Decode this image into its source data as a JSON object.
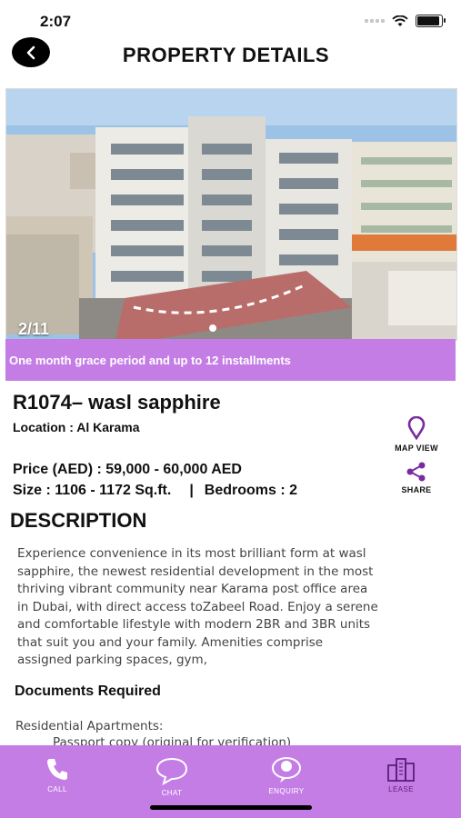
{
  "status": {
    "time": "2:07"
  },
  "header": {
    "title": "PROPERTY DETAILS"
  },
  "gallery": {
    "counter": "2/11"
  },
  "promo": "One month grace period and up to 12 installments",
  "property": {
    "name": "R1074– wasl sapphire",
    "location": "Location :  Al Karama",
    "price": "Price (AED) :   59,000 - 60,000 AED",
    "size": "Size : 1106 - 1172  Sq.ft.",
    "separator": "|",
    "bedrooms": "Bedrooms : 2"
  },
  "actions": {
    "map_view": "MAP VIEW",
    "share": "SHARE"
  },
  "description": {
    "heading": "DESCRIPTION",
    "text": "Experience convenience in its most brilliant form at wasl sapphire, the newest residential development in the most thriving vibrant community near Karama post office area in Dubai, with direct access toZabeel Road. Enjoy a serene and comfortable lifestyle with modern 2BR and 3BR units that suit you and your family. Amenities comprise assigned parking spaces, gym,"
  },
  "documents": {
    "heading": "Documents Required",
    "subheading": "Residential Apartments:",
    "first_item": "Passport copy (original for verification)"
  },
  "bottom_nav": [
    {
      "label": "CALL",
      "icon": "phone-icon"
    },
    {
      "label": "CHAT",
      "icon": "chat-bubble-icon"
    },
    {
      "label": "ENQUIRY",
      "icon": "enquiry-icon"
    },
    {
      "label": "LEASE",
      "icon": "buildings-icon"
    }
  ],
  "colors": {
    "accent": "#c57de6",
    "sky": "#9cc3e6"
  }
}
